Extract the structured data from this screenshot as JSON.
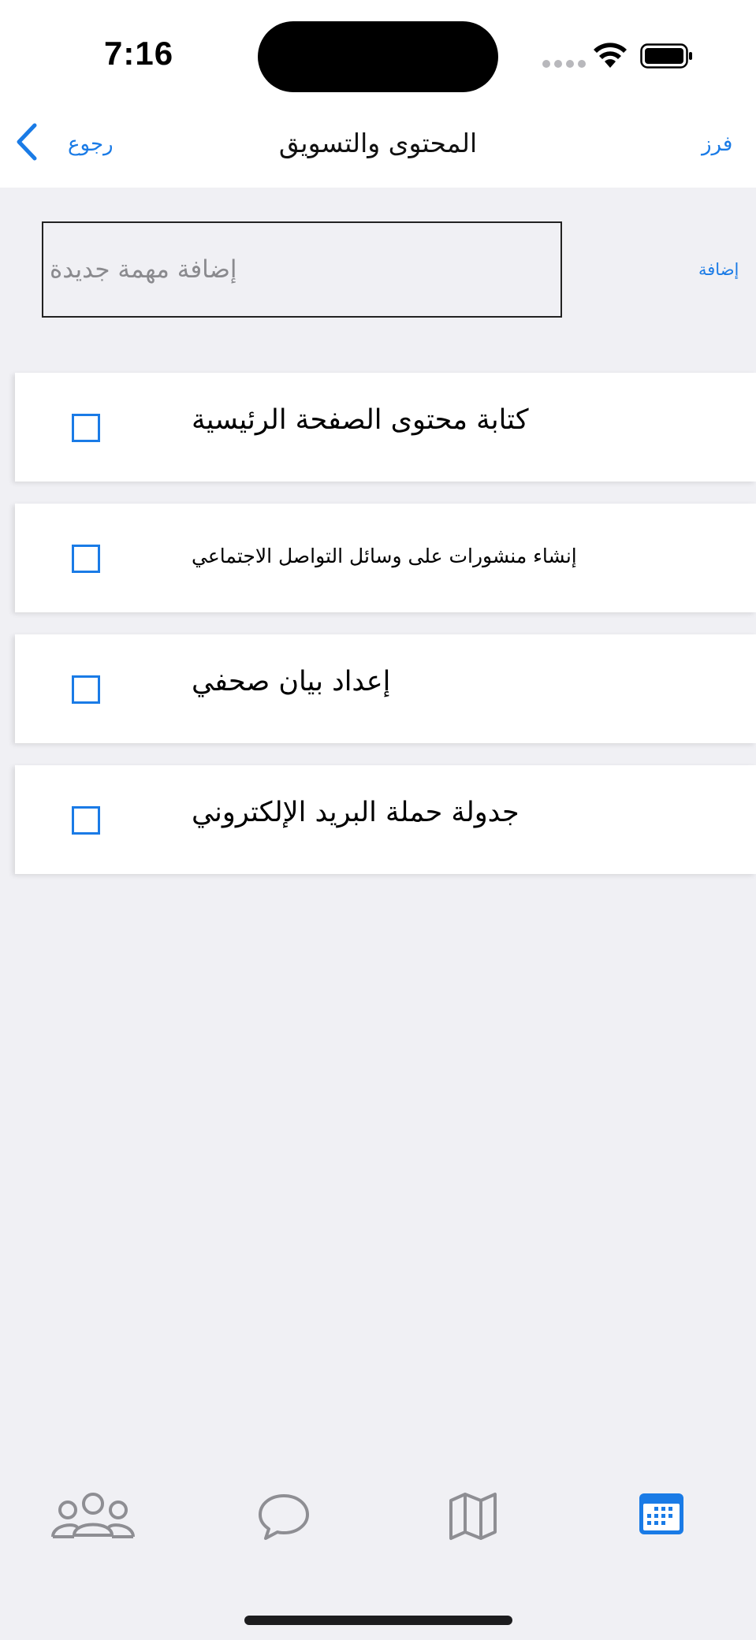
{
  "status_bar": {
    "time": "7:16"
  },
  "nav": {
    "back_label": "رجوع",
    "title": "المحتوى والتسويق",
    "sort_label": "فرز"
  },
  "new_task": {
    "placeholder": "إضافة مهمة جديدة",
    "value": "",
    "add_label": "إضافة"
  },
  "tasks": [
    {
      "label": "كتابة محتوى الصفحة الرئيسية",
      "checked": false
    },
    {
      "label": "إنشاء منشورات على وسائل التواصل الاجتماعي",
      "checked": false
    },
    {
      "label": "إعداد بيان صحفي",
      "checked": false
    },
    {
      "label": "جدولة حملة البريد الإلكتروني",
      "checked": false
    }
  ],
  "tab_bar": {
    "items": [
      {
        "icon": "people-icon",
        "selected": false
      },
      {
        "icon": "chat-bubble-icon",
        "selected": false
      },
      {
        "icon": "map-icon",
        "selected": false
      },
      {
        "icon": "calendar-icon",
        "selected": true
      }
    ]
  },
  "colors": {
    "accent": "#1a7be6",
    "background": "#f0f0f4",
    "card": "#ffffff",
    "inactive_icon": "#8e8e93"
  }
}
